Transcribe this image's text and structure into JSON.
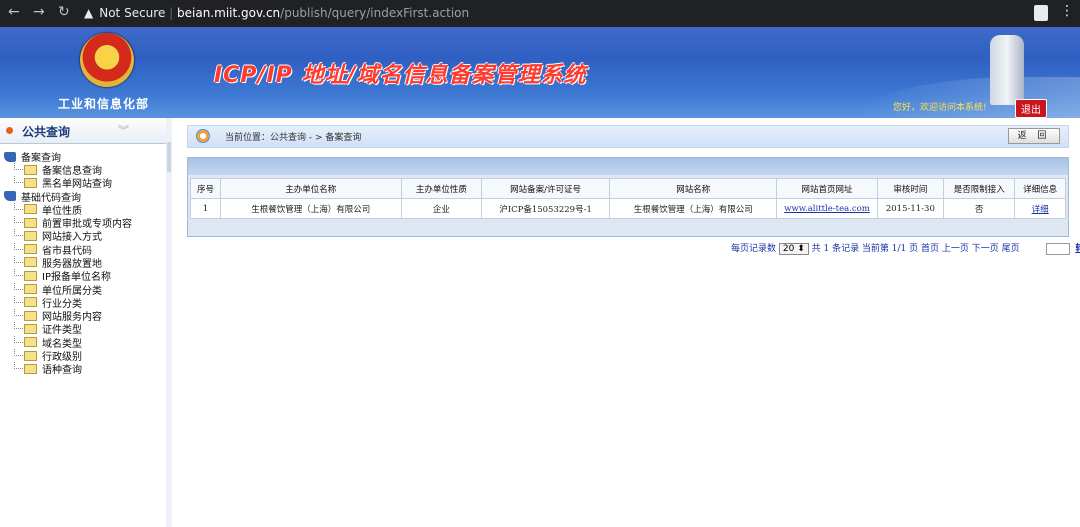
{
  "browser": {
    "security_label": "Not Secure",
    "host": "beian.miit.gov.cn",
    "path": "/publish/query/indexFirst.action"
  },
  "header": {
    "ministry": "工业和信息化部",
    "title": "ICP/IP 地址/域名信息备案管理系统",
    "greeting": "您好，欢迎访问本系统!",
    "logout": "退出"
  },
  "sidebar": {
    "title": "公共查询",
    "groups": [
      {
        "label": "备案查询",
        "items": [
          "备案信息查询",
          "黑名单网站查询"
        ]
      },
      {
        "label": "基础代码查询",
        "items": [
          "单位性质",
          "前置审批或专项内容",
          "网站接入方式",
          "省市县代码",
          "服务器放置地",
          "IP报备单位名称",
          "单位所属分类",
          "行业分类",
          "网站服务内容",
          "证件类型",
          "域名类型",
          "行政级别",
          "语种查询"
        ]
      }
    ]
  },
  "breadcrumb": "当前位置：公共查询 - > 备案查询",
  "back_button": "返 回",
  "table": {
    "headers": [
      "序号",
      "主办单位名称",
      "主办单位性质",
      "网站备案/许可证号",
      "网站名称",
      "网站首页网址",
      "审核时间",
      "是否限制接入",
      "详细信息"
    ],
    "rows": [
      [
        "1",
        "生根餐饮管理（上海）有限公司",
        "企业",
        "沪ICP备15053229号-1",
        "生根餐饮管理（上海）有限公司",
        "www.alittle-tea.com",
        "2015-11-30",
        "否",
        "详细"
      ]
    ]
  },
  "pager": {
    "per_page_label": "每页记录数",
    "per_page_value": "20",
    "summary": "共 1 条记录  当前第 1/1 页 首页 上一页 下一页 尾页",
    "go": "转到"
  }
}
